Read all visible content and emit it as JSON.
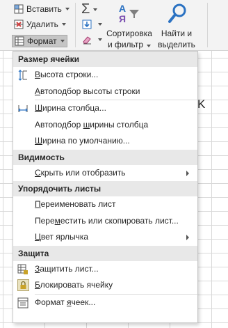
{
  "ribbon": {
    "insert_label": "Вставить",
    "delete_label": "Удалить",
    "format_label": "Формат",
    "sort_filter_line1": "Сортировка",
    "sort_filter_line2": "и фильтр",
    "find_select_line1": "Найти и",
    "find_select_line2": "выделить",
    "sigma_glyph": "Σ",
    "sort_glyph_a": "А",
    "sort_glyph_ya": "Я"
  },
  "grid": {
    "column_letter": "K"
  },
  "menu": {
    "sections": {
      "cell_size": "Размер ячейки",
      "visibility": "Видимость",
      "organize": "Упорядочить листы",
      "protection": "Защита"
    },
    "items": {
      "row_height": {
        "pre": "",
        "u": "В",
        "post": "ысота строки..."
      },
      "autofit_row": {
        "pre": "",
        "u": "А",
        "post": "втоподбор высоты строки"
      },
      "col_width": {
        "pre": "",
        "u": "Ш",
        "post": "ирина столбца..."
      },
      "autofit_col": {
        "pre": "Автоподбор ",
        "u": "ш",
        "post": "ирины столбца"
      },
      "default_width": {
        "pre": "",
        "u": "Ш",
        "post": "ирина по умолчанию..."
      },
      "hide_show": {
        "pre": "",
        "u": "С",
        "post": "крыть или отобразить"
      },
      "rename": {
        "pre": "",
        "u": "П",
        "post": "ереименовать лист"
      },
      "move_copy": {
        "pre": "Пере",
        "u": "м",
        "post": "естить или скопировать лист..."
      },
      "tab_color": {
        "pre": "",
        "u": "Ц",
        "post": "вет ярлычка"
      },
      "protect": {
        "pre": "",
        "u": "З",
        "post": "ащитить лист..."
      },
      "lock": {
        "pre": "",
        "u": "Б",
        "post": "локировать ячейку"
      },
      "format_cells": {
        "pre": "Формат ",
        "u": "я",
        "post": "чеек..."
      }
    }
  },
  "colors": {
    "section_bg": "#e8e8e8",
    "ribbon_bg": "#f3f3f3",
    "accent_blue": "#2b72c2",
    "lock_gold": "#c9a227",
    "delete_red": "#d04040"
  }
}
